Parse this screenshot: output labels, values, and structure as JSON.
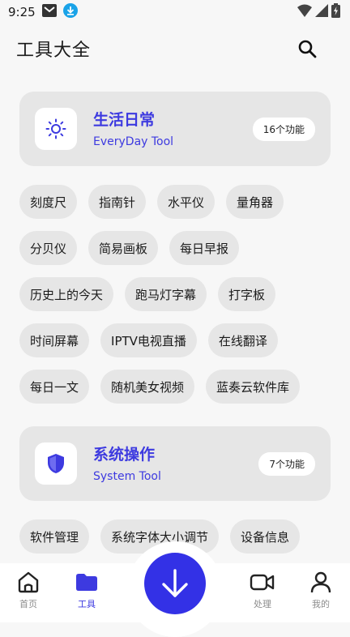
{
  "status": {
    "time": "9:25"
  },
  "header": {
    "title": "工具大全"
  },
  "categories": [
    {
      "title": "生活日常",
      "subtitle": "EveryDay Tool",
      "count": "16个功能"
    },
    {
      "title": "系统操作",
      "subtitle": "System Tool",
      "count": "7个功能"
    }
  ],
  "life_tools": [
    "刻度尺",
    "指南针",
    "水平仪",
    "量角器",
    "分贝仪",
    "简易画板",
    "每日早报",
    "历史上的今天",
    "跑马灯字幕",
    "打字板",
    "时间屏幕",
    "IPTV电视直播",
    "在线翻译",
    "每日一文",
    "随机美女视频",
    "蓝奏云软件库"
  ],
  "system_tools": [
    "软件管理",
    "系统字体大小调节",
    "设备信息"
  ],
  "nav": [
    {
      "label": "首页"
    },
    {
      "label": "工具"
    },
    {
      "label": "处理"
    },
    {
      "label": "我的"
    }
  ],
  "colors": {
    "accent": "#3d3ae0",
    "card": "#e6e6e6",
    "background": "#f7f7f7"
  }
}
